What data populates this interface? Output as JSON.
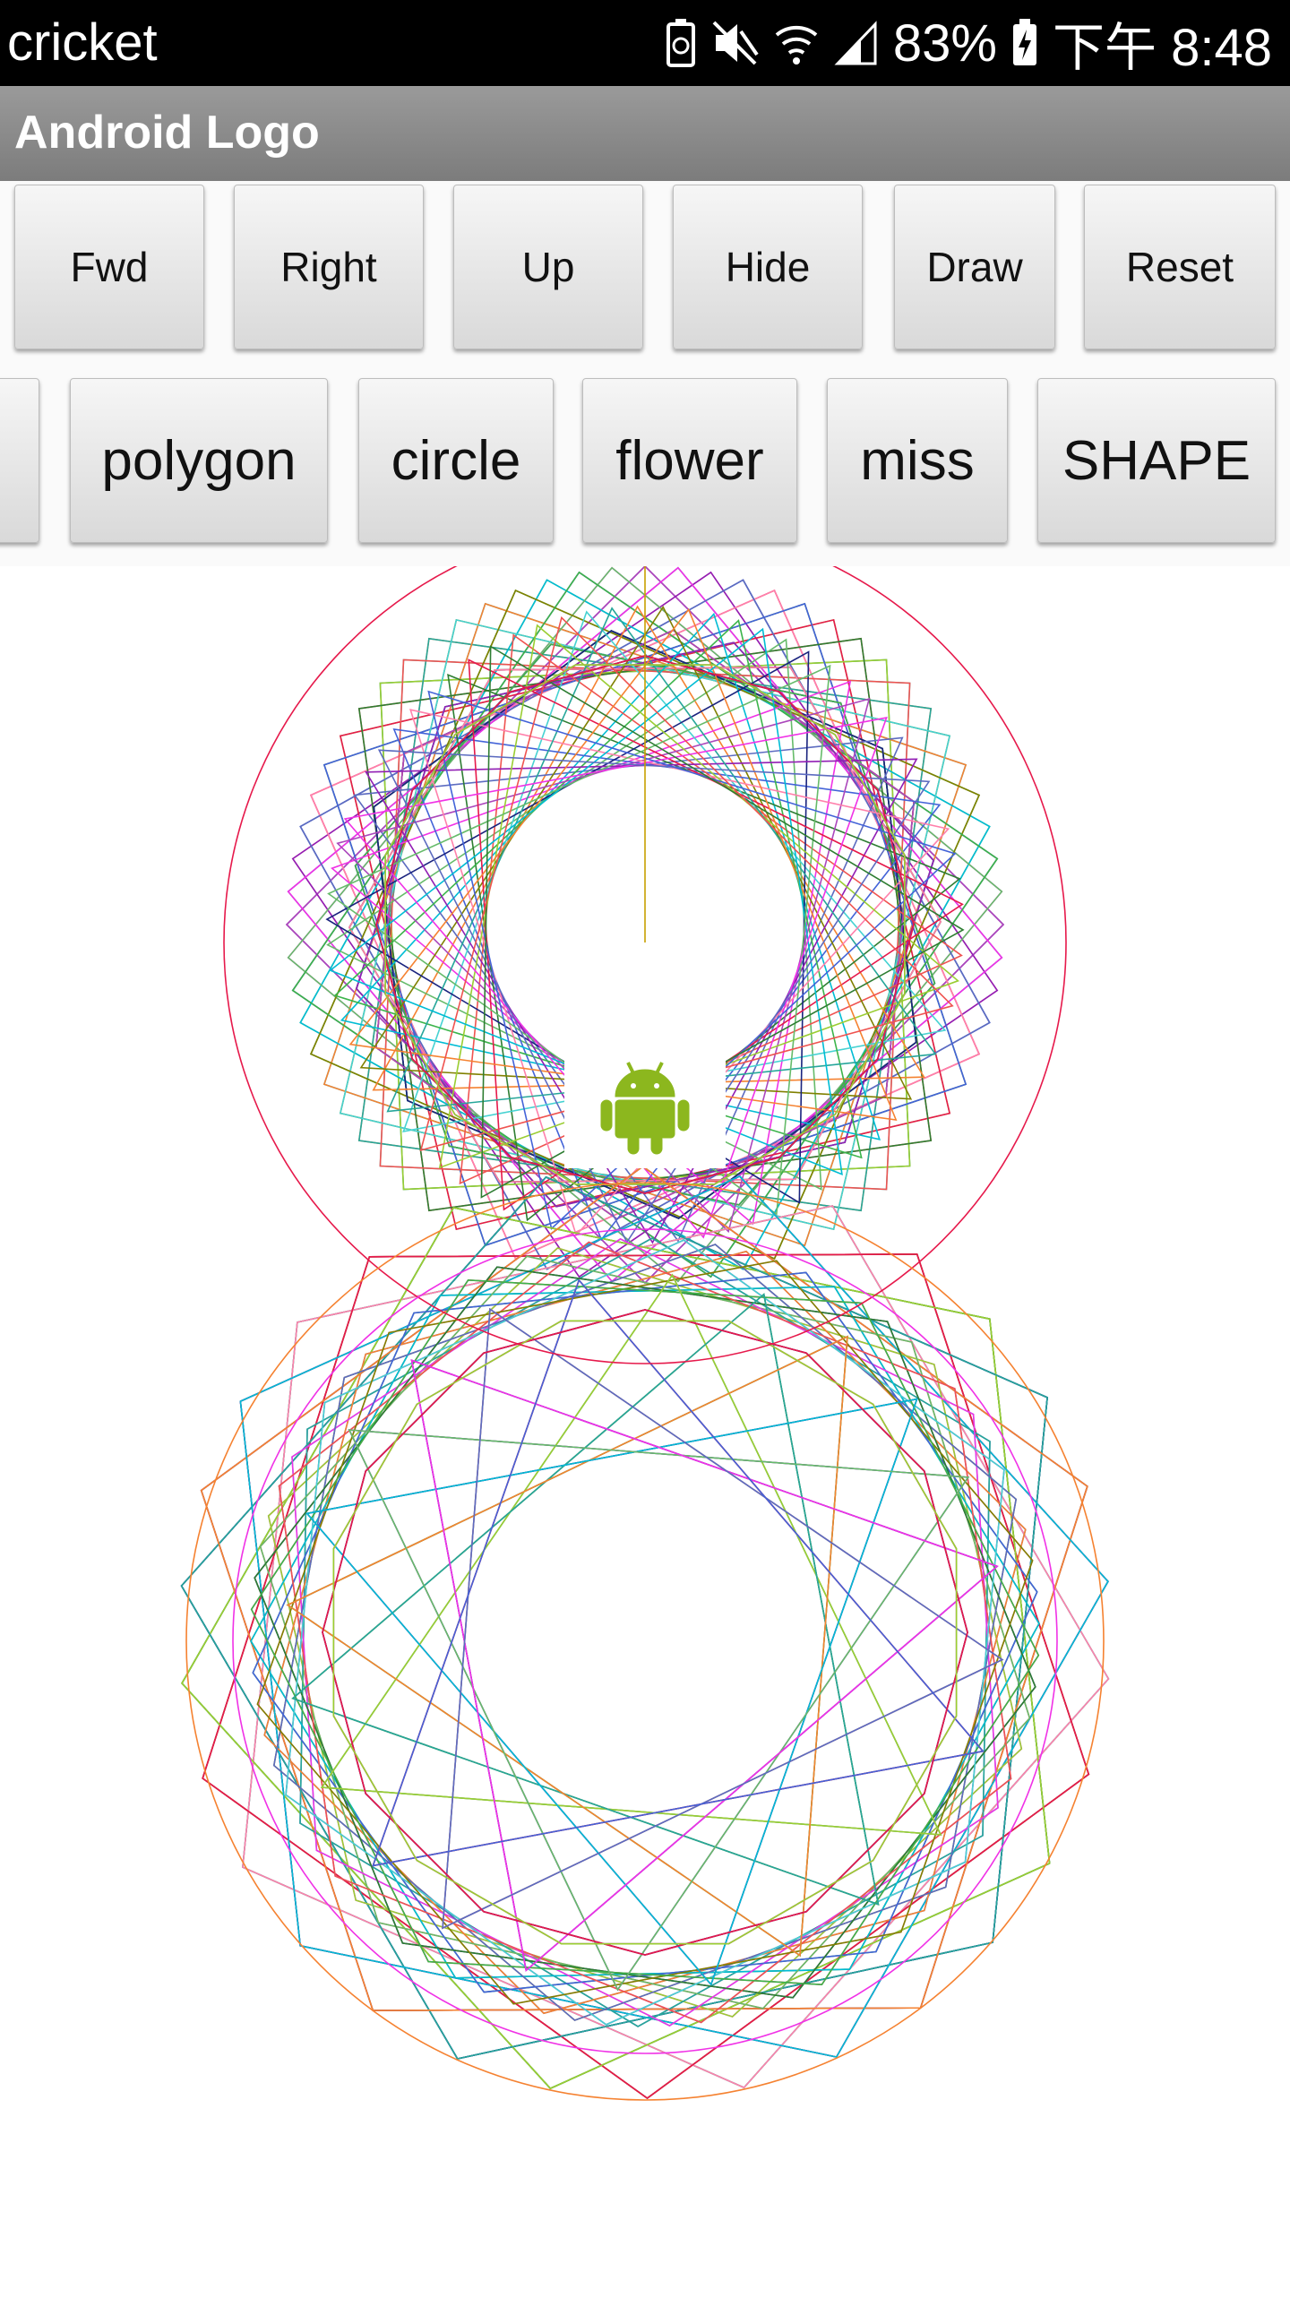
{
  "status_bar": {
    "carrier": "cricket",
    "battery_percent": "83%",
    "time": "下午 8:48",
    "icons": [
      "battery-saver-icon",
      "mute-icon",
      "wifi-icon",
      "signal-icon",
      "battery-charging-icon"
    ]
  },
  "app": {
    "title": "Android Logo"
  },
  "toolbar_row1": {
    "buttons": [
      "Fwd",
      "Right",
      "Up",
      "Hide",
      "Draw",
      "Reset"
    ]
  },
  "toolbar_row2": {
    "buttons": [
      "",
      "polygon",
      "circle",
      "flower",
      "miss",
      "SHAPE"
    ]
  },
  "canvas": {
    "sprite": "android-robot-icon",
    "sprite_color": "#8cb71e"
  },
  "colors": {
    "status_bar": "#000000",
    "title_bar": "#8a8a8a",
    "button_face": "#e6e6e6"
  }
}
